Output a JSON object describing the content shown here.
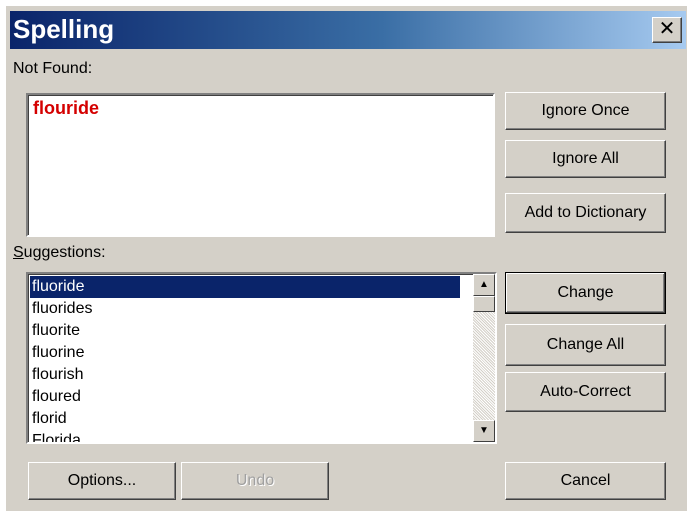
{
  "window": {
    "title": "Spelling",
    "close_glyph": "✕"
  },
  "not_found": {
    "label": "Not Found:",
    "word": "flouride"
  },
  "suggestions": {
    "label_accel": "S",
    "label_rest": "uggestions:",
    "items": [
      "fluoride",
      "fluorides",
      "fluorite",
      "fluorine",
      "flourish",
      "floured",
      "florid",
      "Florida"
    ],
    "selected": "fluoride"
  },
  "buttons": {
    "ignore_once": "Ignore Once",
    "ignore_all": "Ignore All",
    "add_to_dictionary": "Add to Dictionary",
    "change": "Change",
    "change_all": "Change All",
    "auto_correct": "Auto-Correct",
    "options": "Options...",
    "undo": "Undo",
    "cancel": "Cancel"
  },
  "scrollbar": {
    "up_glyph": "▲",
    "down_glyph": "▼"
  },
  "colors": {
    "title_start": "#0a246a",
    "title_end": "#a6caf0",
    "not_found_word": "#d40000",
    "selection": "#0a246a",
    "face": "#d4d0c8"
  }
}
